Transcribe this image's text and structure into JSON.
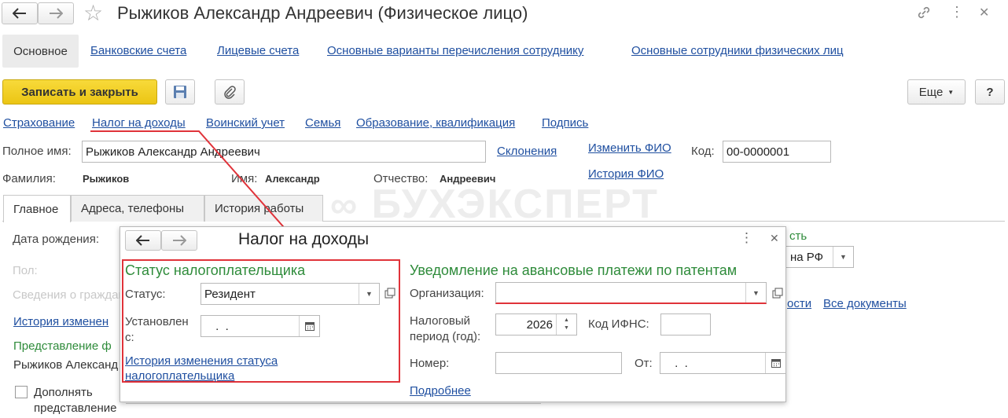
{
  "window": {
    "title": "Рыжиков Александр Андреевич (Физическое лицо)"
  },
  "nav_tabs": [
    "Основное",
    "Банковские счета",
    "Лицевые счета",
    "Основные варианты перечисления сотруднику",
    "Основные сотрудники физических лиц"
  ],
  "toolbar": {
    "save_close": "Записать и закрыть",
    "more": "Еще",
    "help": "?"
  },
  "sublinks": [
    "Страхование",
    "Налог на доходы",
    "Воинский учет",
    "Семья",
    "Образование, квалификация",
    "Подпись"
  ],
  "person": {
    "full_name_label": "Полное имя:",
    "full_name_value": "Рыжиков Александр Андреевич",
    "declensions_link": "Склонения",
    "change_fio_link": "Изменить ФИО",
    "fio_history_link": "История ФИО",
    "code_label": "Код:",
    "code_value": "00-0000001",
    "surname_label": "Фамилия:",
    "surname_value": "Рыжиков",
    "name_label": "Имя:",
    "name_value": "Александр",
    "patronymic_label": "Отчество:",
    "patronymic_value": "Андреевич"
  },
  "content_tabs": [
    "Главное",
    "Адреса, телефоны",
    "История работы"
  ],
  "main_tab": {
    "birthdate_label": "Дата рождения:",
    "gender_label": "Пол:",
    "info_label": "Сведения о гражданстве",
    "history_link": "История изменен",
    "representation_label": "Представление ф",
    "representation_value": "Рыжиков Александ",
    "complement_checkbox_label": "Дополнять представление",
    "right_label_partial": "сть",
    "citizenship_value": "на РФ",
    "right_link_partial": "ости",
    "all_docs_link": "Все документы"
  },
  "watermark": "БУХЭКСПЕРТ",
  "popup": {
    "title": "Налог на доходы",
    "status_section_title": "Статус налогоплательщика",
    "status_label": "Статус:",
    "status_value": "Резидент",
    "set_from_label": "Установлен с:",
    "set_from_value": " .  .",
    "status_history_link": "История изменения статуса налогоплательщика",
    "notice_section_title": "Уведомление на авансовые платежи по патентам",
    "org_label": "Организация:",
    "org_value": "",
    "tax_period_label": "Налоговый период (год):",
    "tax_period_value": "2026",
    "ifns_label": "Код ИФНС:",
    "ifns_value": "",
    "number_label": "Номер:",
    "number_value": "",
    "from_label": "От:",
    "from_value": " .  .",
    "more_link": "Подробнее"
  },
  "colors": {
    "accent_yellow": "#f5d01b",
    "link_blue": "#1f4fa0",
    "section_green": "#2e8b3a",
    "highlight_red": "#e0333a"
  }
}
